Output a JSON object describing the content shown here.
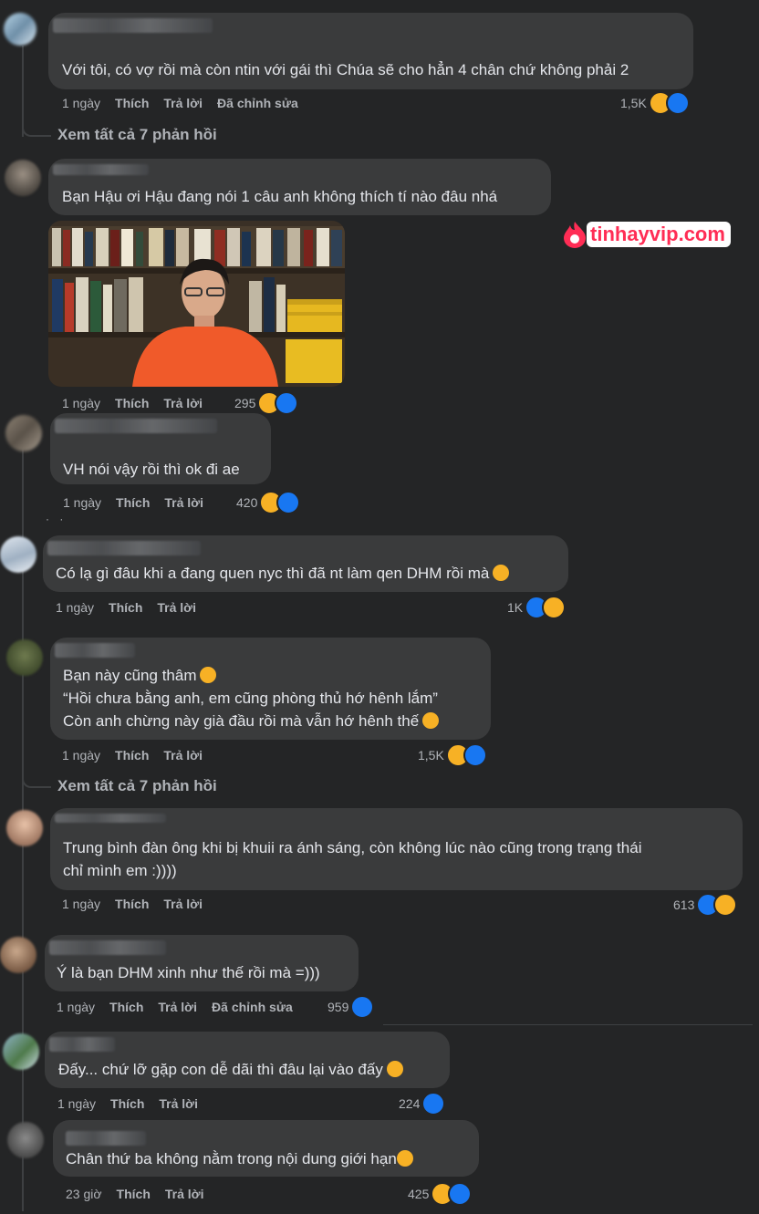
{
  "comments": [
    {
      "text": "Với tôi, có vợ rồi mà còn ntin với gái thì Chúa sẽ cho hẳn 4 chân chứ không phải 2",
      "time": "1 ngày",
      "like": "Thích",
      "reply": "Trả lời",
      "edited": "Đã chỉnh sửa",
      "count": "1,5K"
    },
    {
      "text": "Bạn Hậu ơi Hậu đang nói 1 câu anh không thích tí nào đâu nhá",
      "time": "1 ngày",
      "like": "Thích",
      "reply": "Trả lời",
      "count": "295"
    },
    {
      "text": "VH nói vậy rồi thì ok đi ae",
      "time": "1 ngày",
      "like": "Thích",
      "reply": "Trả lời",
      "count": "420"
    },
    {
      "text": "Có lạ gì đâu khi a đang quen nyc thì đã nt làm qen DHM rồi mà",
      "time": "1 ngày",
      "like": "Thích",
      "reply": "Trả lời",
      "count": "1K"
    },
    {
      "lines": [
        "Bạn này cũng thâm",
        "“Hồi chưa bằng anh, em cũng phòng thủ hớ hênh lắm”",
        "Còn anh chừng này già đầu rồi mà vẫn hớ hênh thế"
      ],
      "time": "1 ngày",
      "like": "Thích",
      "reply": "Trả lời",
      "count": "1,5K"
    },
    {
      "lines": [
        "Trung bình đàn ông khi bị khuii ra ánh sáng, còn không lúc nào cũng trong trạng thái",
        "chỉ mình em :))))"
      ],
      "time": "1 ngày",
      "like": "Thích",
      "reply": "Trả lời",
      "count": "613"
    },
    {
      "text": "Ý là bạn DHM xinh như thế rồi mà =)))",
      "time": "1 ngày",
      "like": "Thích",
      "reply": "Trả lời",
      "edited": "Đã chỉnh sửa",
      "count": "959"
    },
    {
      "text": "Đấy... chứ lỡ gặp con dễ dãi thì đâu lại vào đấy",
      "time": "1 ngày",
      "like": "Thích",
      "reply": "Trả lời",
      "count": "224"
    },
    {
      "text": "Chân thứ ba không nằm trong nội dung giới hạn",
      "time": "23 giờ",
      "like": "Thích",
      "reply": "Trả lời",
      "count": "425"
    }
  ],
  "see_all_replies": "Xem tất cả 7 phản hồi",
  "watermark": {
    "brand": "tinhayvip",
    "domain": ".com"
  },
  "colors": {
    "bg": "#242526",
    "bubble": "#3a3b3c",
    "like": "#1877f2",
    "haha": "#f7b125",
    "watermark": "#ff2d55"
  }
}
